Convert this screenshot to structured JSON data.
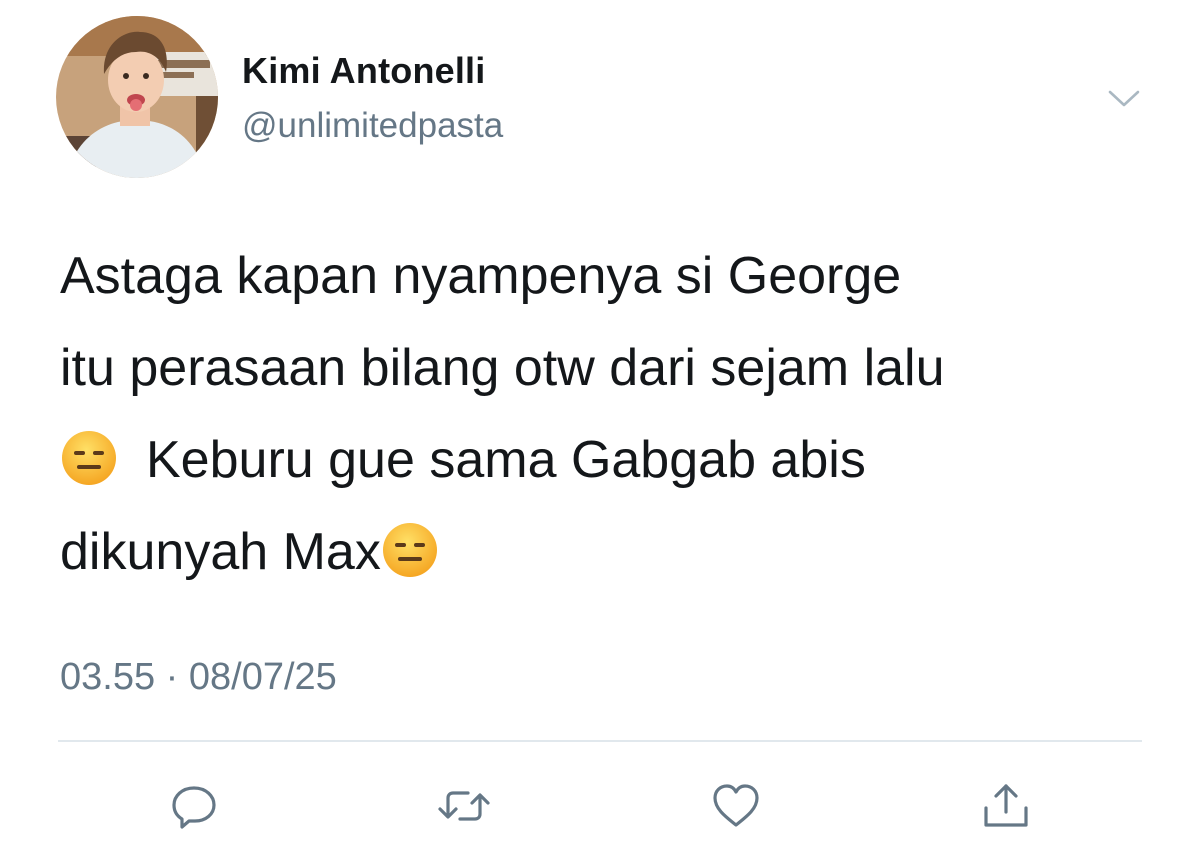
{
  "user": {
    "display_name": "Kimi Antonelli",
    "handle": "@unlimitedpasta"
  },
  "tweet": {
    "line1": "Astaga kapan nyampenya si George",
    "line2": "itu perasaan bilang otw dari sejam lalu",
    "line3": "Keburu gue sama Gabgab abis",
    "line4": "dikunyah Max",
    "emoji": "expressionless-face",
    "timestamp": "03.55 · 08/07/25"
  },
  "actions": [
    "reply-icon",
    "retweet-icon",
    "like-icon",
    "share-icon"
  ],
  "colors": {
    "text": "#14171a",
    "secondary": "#657786",
    "divider": "#e1e8ed"
  }
}
